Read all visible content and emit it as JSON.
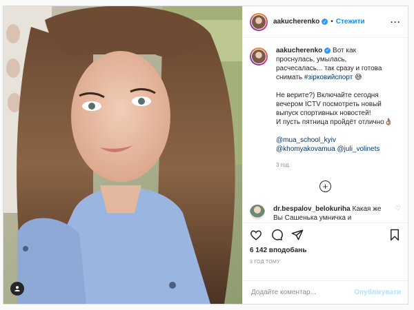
{
  "post": {
    "author": "aakucherenko",
    "follow_label": "Стежити",
    "dot": "•",
    "more_icon": "more-horizontal-icon",
    "caption": {
      "line1_text": "Вот как проснулась, умылась, расчесалась... так сразу и готова снимать ",
      "hashtag": "#зірковийспорт",
      "emoji1": "😅",
      "para2": "Не верите?) Включайте сегодня вечером ICTV посмотреть новый выпуск спортивных новостей!",
      "para3": "И пусть пятница пройдёт отлично👌🏽",
      "mention1": "@mua_school_kyiv",
      "mention2": "@khomyakovamua",
      "mention3": "@juli_volinets",
      "time": "3 год."
    },
    "comment": {
      "author": "dr.bespalov_belokuriha",
      "text": "Какая же Вы Сашенька умничка и красавица!Как и где Вас сразу"
    },
    "likes": "6 142 вподобань",
    "ago": "3 ГОД ТОМУ",
    "comment_placeholder": "Додайте коментар...",
    "publish_label": "Опублікувати"
  },
  "colors": {
    "accent": "#0095f6",
    "publish_disabled": "#b2dffc",
    "verified": "#3897f0"
  }
}
